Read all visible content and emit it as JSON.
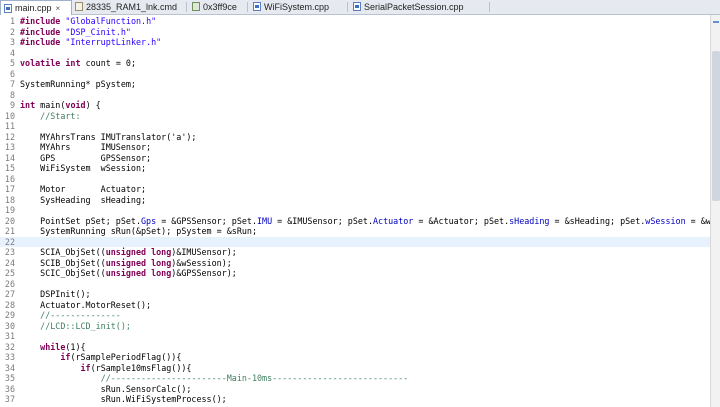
{
  "tabs": [
    {
      "label": "main.cpp",
      "icon": "cpp-file-icon",
      "active": true,
      "close": "×"
    },
    {
      "label": "28335_RAM1_lnk.cmd",
      "icon": "cmd-file-icon",
      "active": false
    },
    {
      "label": "0x3ff9ce",
      "icon": "disassembly-icon",
      "active": false
    },
    {
      "label": "WiFiSystem.cpp",
      "icon": "cpp-file-icon",
      "active": false
    },
    {
      "label": "SerialPacketSession.cpp",
      "icon": "cpp-file-icon",
      "active": false
    }
  ],
  "editor": {
    "current_line": 22,
    "lines": [
      {
        "n": "1",
        "segs": [
          [
            "kw",
            "#include"
          ],
          [
            "",
            " "
          ],
          [
            "str",
            "\"GlobalFunction.h\""
          ]
        ]
      },
      {
        "n": "2",
        "segs": [
          [
            "kw",
            "#include"
          ],
          [
            "",
            " "
          ],
          [
            "str",
            "\"DSP_Cinit.h\""
          ]
        ]
      },
      {
        "n": "3",
        "segs": [
          [
            "kw",
            "#include"
          ],
          [
            "",
            " "
          ],
          [
            "str",
            "\"InterruptLinker.h\""
          ]
        ]
      },
      {
        "n": "4",
        "segs": []
      },
      {
        "n": "5",
        "segs": [
          [
            "kw",
            "volatile"
          ],
          [
            "",
            " "
          ],
          [
            "kw",
            "int"
          ],
          [
            "",
            " count = 0;"
          ]
        ]
      },
      {
        "n": "6",
        "segs": []
      },
      {
        "n": "7",
        "segs": [
          [
            "",
            "SystemRunning* pSystem;"
          ]
        ]
      },
      {
        "n": "8",
        "segs": []
      },
      {
        "n": "9",
        "segs": [
          [
            "kw",
            "int"
          ],
          [
            "",
            " main("
          ],
          [
            "kw",
            "void"
          ],
          [
            "",
            ") {"
          ]
        ]
      },
      {
        "n": "10",
        "segs": [
          [
            "",
            "    "
          ],
          [
            "cm",
            "//Start:"
          ]
        ]
      },
      {
        "n": "11",
        "segs": []
      },
      {
        "n": "12",
        "segs": [
          [
            "",
            "    MYAhrsTrans IMUTranslator('a');"
          ]
        ]
      },
      {
        "n": "13",
        "segs": [
          [
            "",
            "    MYAhrs      IMUSensor;"
          ]
        ]
      },
      {
        "n": "14",
        "segs": [
          [
            "",
            "    GPS         GPSSensor;"
          ]
        ]
      },
      {
        "n": "15",
        "segs": [
          [
            "",
            "    WiFiSystem  wSession;"
          ]
        ]
      },
      {
        "n": "16",
        "segs": []
      },
      {
        "n": "17",
        "segs": [
          [
            "",
            "    Motor       Actuator;"
          ]
        ]
      },
      {
        "n": "18",
        "segs": [
          [
            "",
            "    SysHeading  sHeading;"
          ]
        ]
      },
      {
        "n": "19",
        "segs": []
      },
      {
        "n": "20",
        "segs": [
          [
            "",
            "    PointSet pSet; pSet."
          ],
          [
            "fld",
            "Gps"
          ],
          [
            "",
            " = &GPSSensor; pSet."
          ],
          [
            "fld",
            "IMU"
          ],
          [
            "",
            " = &IMUSensor; pSet."
          ],
          [
            "fld",
            "Actuator"
          ],
          [
            "",
            " = &Actuator; pSet."
          ],
          [
            "fld",
            "sHeading"
          ],
          [
            "",
            " = &sHeading; pSet."
          ],
          [
            "fld",
            "wSession"
          ],
          [
            "",
            " = &wSess"
          ]
        ]
      },
      {
        "n": "21",
        "segs": [
          [
            "",
            "    SystemRunning sRun(&pSet); pSystem = &sRun;"
          ]
        ]
      },
      {
        "n": "22",
        "segs": []
      },
      {
        "n": "23",
        "segs": [
          [
            "",
            "    SCIA_ObjSet(("
          ],
          [
            "kw",
            "unsigned long"
          ],
          [
            "",
            ")&IMUSensor);"
          ]
        ]
      },
      {
        "n": "24",
        "segs": [
          [
            "",
            "    SCIB_ObjSet(("
          ],
          [
            "kw",
            "unsigned long"
          ],
          [
            "",
            ")&wSession);"
          ]
        ]
      },
      {
        "n": "25",
        "segs": [
          [
            "",
            "    SCIC_ObjSet(("
          ],
          [
            "kw",
            "unsigned long"
          ],
          [
            "",
            ")&GPSSensor);"
          ]
        ]
      },
      {
        "n": "26",
        "segs": []
      },
      {
        "n": "27",
        "segs": [
          [
            "",
            "    DSPInit();"
          ]
        ]
      },
      {
        "n": "28",
        "segs": [
          [
            "",
            "    Actuator.MotorReset();"
          ]
        ]
      },
      {
        "n": "29",
        "segs": [
          [
            "",
            "    "
          ],
          [
            "cm",
            "//--------------"
          ]
        ]
      },
      {
        "n": "30",
        "segs": [
          [
            "",
            "    "
          ],
          [
            "cm",
            "//LCD::LCD_init();"
          ]
        ]
      },
      {
        "n": "31",
        "segs": []
      },
      {
        "n": "32",
        "segs": [
          [
            "",
            "    "
          ],
          [
            "kw",
            "while"
          ],
          [
            "",
            "(1){"
          ]
        ]
      },
      {
        "n": "33",
        "segs": [
          [
            "",
            "        "
          ],
          [
            "kw",
            "if"
          ],
          [
            "",
            "(rSamplePeriodFlag()){"
          ]
        ]
      },
      {
        "n": "34",
        "segs": [
          [
            "",
            "            "
          ],
          [
            "kw",
            "if"
          ],
          [
            "",
            "(rSample10msFlag()){"
          ]
        ]
      },
      {
        "n": "35",
        "segs": [
          [
            "",
            "                "
          ],
          [
            "cm",
            "//-----------------------Main-10ms---------------------------"
          ]
        ]
      },
      {
        "n": "36",
        "segs": [
          [
            "",
            "                sRun.SensorCalc();"
          ]
        ]
      },
      {
        "n": "37",
        "segs": [
          [
            "",
            "                sRun.WiFiSystemProcess();"
          ]
        ]
      }
    ]
  },
  "colors": {
    "keyword": "#7f0055",
    "string": "#2a00ff",
    "comment": "#3f7f5f",
    "field": "#0000c0",
    "current_line": "#e8f2fe"
  }
}
